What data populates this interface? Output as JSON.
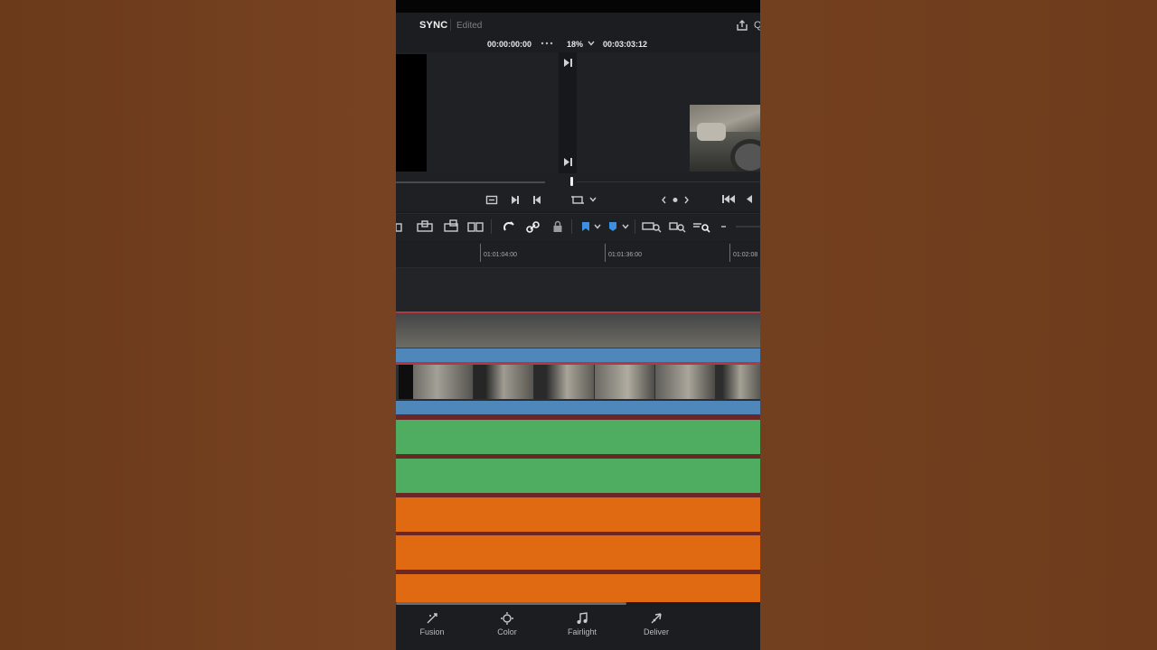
{
  "header": {
    "title": "SYNC",
    "status": "Edited",
    "q_char": "Q"
  },
  "timecodes": {
    "current": "00:00:00:00",
    "zoom": "18%",
    "duration": "00:03:03:12"
  },
  "ruler": {
    "labels": [
      "01:01:04:00",
      "01:01:36:00",
      "01:02:08"
    ]
  },
  "colors": {
    "video_clip_border": "#b03a42",
    "video_bar": "#4f87bb",
    "audio_green": "#4fad62",
    "audio_orange": "#e06a12"
  },
  "icons": {
    "transport": [
      "loop-icon",
      "step-forward-icon",
      "step-back-icon",
      "crop-icon",
      "dots-nav-icon",
      "skip-start-icon",
      "play-reverse-icon"
    ],
    "toolbar": [
      "edit-tool-icon",
      "insert-icon",
      "overwrite-icon",
      "replace-icon",
      "snap-icon",
      "link-icon",
      "lock-icon",
      "flag-icon",
      "marker-icon",
      "zoom-fit-icon",
      "zoom-detail-icon",
      "zoom-custom-icon",
      "zoom-slider-icon"
    ]
  },
  "bottom_nav": [
    {
      "label": "Fusion",
      "icon": "fusion-icon"
    },
    {
      "label": "Color",
      "icon": "color-icon"
    },
    {
      "label": "Fairlight",
      "icon": "fairlight-icon"
    },
    {
      "label": "Deliver",
      "icon": "deliver-icon"
    }
  ]
}
